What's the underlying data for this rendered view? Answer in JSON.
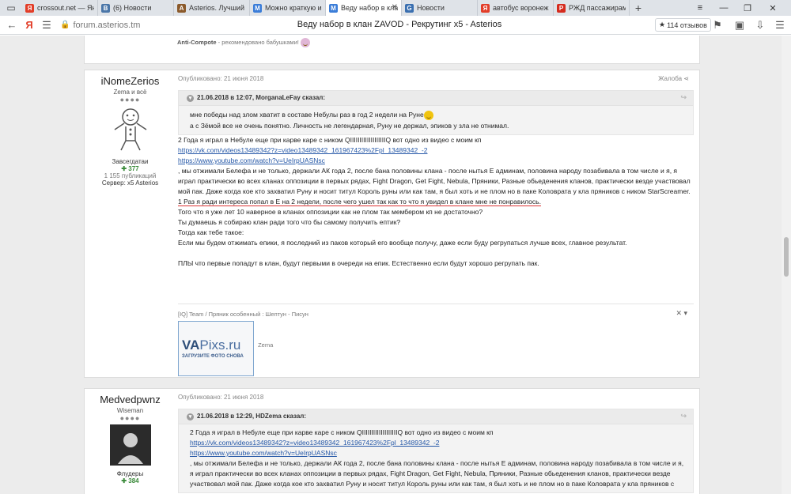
{
  "browser": {
    "tabs": [
      {
        "title": "crossout.net — Яндекс",
        "color": "#e23d28",
        "glyph": "Я"
      },
      {
        "title": "(6) Новости",
        "color": "#4a76a8",
        "glyph": "В"
      },
      {
        "title": "Asterios. Лучший игровой",
        "color": "#8b5a2b",
        "glyph": "A"
      },
      {
        "title": "Можно краткую историю",
        "color": "#3b7dd8",
        "glyph": "M"
      },
      {
        "title": "Веду набор в клан",
        "color": "#3b7dd8",
        "glyph": "M",
        "active": true
      },
      {
        "title": "Новости",
        "color": "#3a6fb0",
        "glyph": "G"
      },
      {
        "title": "автобус воронеж москва",
        "color": "#e23d28",
        "glyph": "Я"
      },
      {
        "title": "РЖД пассажирам. На",
        "color": "#d52b1e",
        "glyph": "Р"
      }
    ],
    "url": "forum.asterios.tm",
    "page_title": "Веду набор в клан ZAVOD - Рекрутинг x5 - Asterios",
    "reviews": "114 отзывов"
  },
  "prev_post": {
    "signature": "Anti-Compote",
    "signature_rest": " - рекомендовано бабушками!"
  },
  "posts": [
    {
      "author": "iNomeZerios",
      "rank": "Zema и всё",
      "dots": "●●●●",
      "group": "Завсегдатаи",
      "rep": "377",
      "posts_count": "1 155 публикаций",
      "server": "Сервер: x5 Asterios",
      "published": "Опубликовано: 21 июня 2018",
      "report": "Жалоба",
      "quote_head": "21.06.2018 в 12:07, MorganaLeFay сказал:",
      "quote_lines": [
        "мне победы над злом хватит в составе Небулы раз в год 2 недели на Руне",
        "а с Зёмой все не очень понятно. Личность не легендарная, Руну не держал, эпиков у зла не отнимал."
      ],
      "lines": [
        "2 Года я играл в Небуле еще при карве каре с ником QIIIIIIIIIIIIIIIIIIIQ  вот одно из видео с моим кп",
        "https://vk.com/videos13489342?z=video13489342_161967423%2Fpl_13489342_-2",
        "https://www.youtube.com/watch?v=UeIrpUASNsc",
        ", мы отжимали Белефа и не только, держали АК года 2, после бана половины клана - после нытья Е админам, половина народу позабивала в том числе и я, я играл практически во всех кланах оппозиции в первых рядах, Fight Dragon, Get Fight, Nebula, Пряники, Разные обьеденения кланов, практически везде участвовал мой пак. Даже когда кое кто захватил Руну и носит титул Король руны или как там, я был хоть и не плом но в паке Коловрата у кла пряников с ником StarScreamer.",
        "1 Раз я ради интереса попал в Е на 2 недели, после чего ушел так как то что я увидел в клане мне не понравилось.",
        "Того что я уже лет 10 наверное в кланах оппозиции как не плом так мембером кп не достаточно?",
        "Ты думаешь я собираю клан ради того что бы самому получить ептик?",
        "Тогда как тебе такое:",
        "Если мы будем отжимать епики, я последний из паков который его вообще получу, даже если буду регрупаться лучше всех, главное результат.",
        "ПЛЫ что первые попадут в клан, будут первыми в очереди на епик. Естественно если будут хорошо регрупать пак."
      ],
      "signature": "[IQ] Team / Пряник особенный : Шептун - Писун",
      "pix_logo_a": "VA",
      "pix_logo_b": "Pixs.ru",
      "pix_caption": "ЗАГРУЗИТЕ ФОТО СНОВА",
      "pix_name": "Zema"
    },
    {
      "author": "Medvedpwnz",
      "rank": "Wiseman",
      "dots": "●●●●",
      "group": "Флудеры",
      "rep": "384",
      "published": "Опубликовано: 21 июня 2018",
      "quote_head": "21.06.2018 в 12:29, HDZema сказал:",
      "quote_lines": [
        "2 Года я играл в Небуле еще при карве каре с ником QIIIIIIIIIIIIIIIIIIIQ  вот одно из видео с моим кп",
        "https://vk.com/videos13489342?z=video13489342_161967423%2Fpl_13489342_-2",
        "https://www.youtube.com/watch?v=UeIrpUASNsc",
        ", мы отжимали Белефа и не только, держали АК года 2, после бана половины клана - после нытья Е админам, половина народу позабивала в том числе и я, я играл практически во всех кланах оппозиции в первых рядах, Fight Dragon, Get Fight, Nebula, Пряники, Разные обьеденения кланов, практически везде участвовал мой пак. Даже когда кое кто захватил Руну и носит титул Король руны или как там, я был хоть и не плом но в паке Коловрата у кла пряников с"
      ]
    }
  ]
}
